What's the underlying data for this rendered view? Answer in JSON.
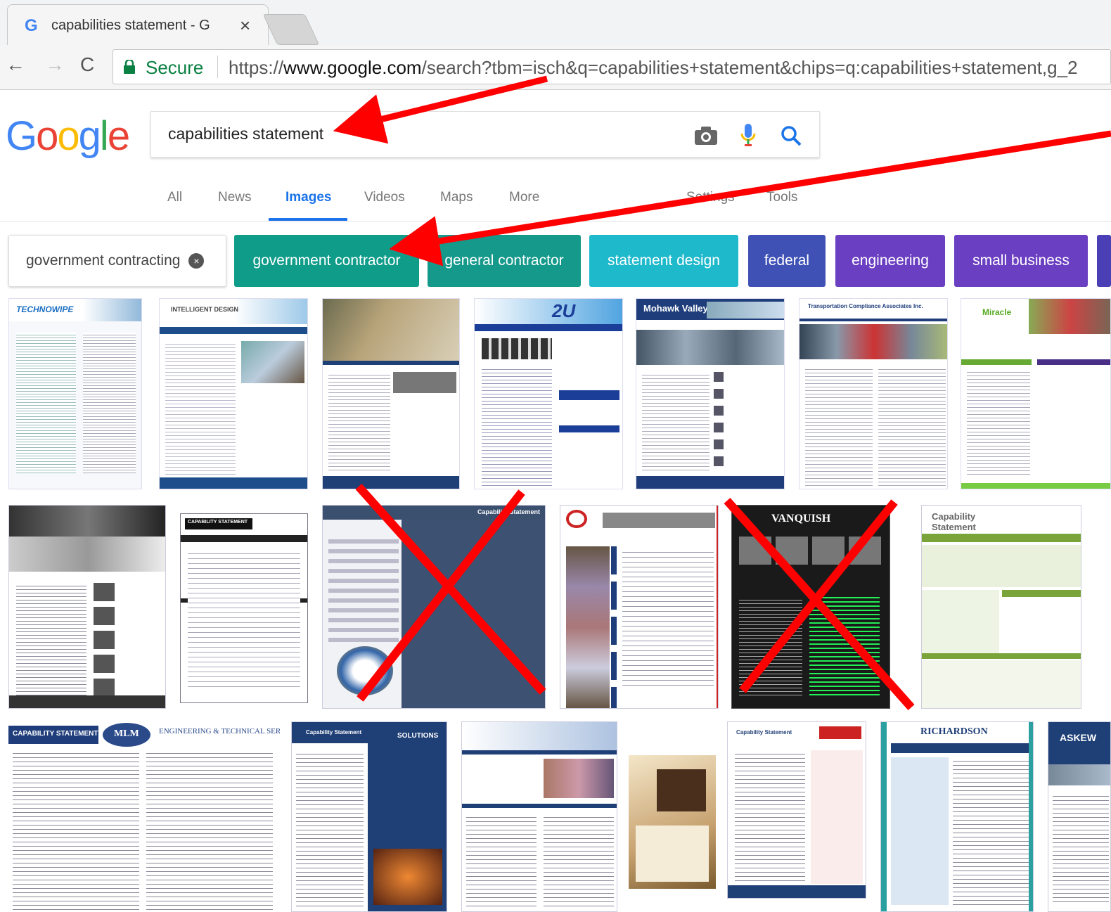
{
  "browser": {
    "tab_title": "capabilities statement - G",
    "tab_favicon": "G",
    "close_icon": "×",
    "back_icon": "←",
    "forward_icon": "→",
    "reload_icon": "C",
    "secure_label": "Secure",
    "url_scheme": "https://",
    "url_host": "www.google.com",
    "url_path": "/search?tbm=isch&q=capabilities+statement&chips=q:capabilities+statement,g_2"
  },
  "google": {
    "logo": [
      "G",
      "o",
      "o",
      "g",
      "l",
      "e"
    ],
    "search_value": "capabilities statement",
    "tabs": [
      "All",
      "News",
      "Images",
      "Videos",
      "Maps",
      "More",
      "Settings",
      "Tools"
    ],
    "active_tab": "Images",
    "chips": [
      {
        "label": "government contracting",
        "color": "#ffffff",
        "selected": true,
        "remove_icon": "×"
      },
      {
        "label": "government contractor",
        "color": "#0f9d8a"
      },
      {
        "label": "general contractor",
        "color": "#14998a"
      },
      {
        "label": "statement design",
        "color": "#1fb9cc"
      },
      {
        "label": "federal",
        "color": "#3f51b5"
      },
      {
        "label": "engineering",
        "color": "#6a3fc1"
      },
      {
        "label": "small business",
        "color": "#6a3fc1"
      }
    ]
  },
  "thumbnails": {
    "row1": [
      "TECHNOWIPE",
      "INTELLIGENT DESIGN",
      "",
      "2U",
      "Mohawk Valley",
      "Transportation Compliance Associates Inc.",
      "Miracle"
    ],
    "row2": [
      "",
      "CAPABILITY STATEMENT",
      "Capability Statement",
      "",
      "VANQUISH",
      "Capability Statement",
      ""
    ],
    "row3": [
      "CAPABILITY STATEMENT",
      "MLM",
      "ENGINEERING & TECHNICAL SERVICES",
      "Capability Statement",
      "SOLUTIONS",
      "",
      "",
      "Capability Statement",
      "RICHARDSON",
      "ASKEW"
    ]
  },
  "colors": {
    "annotation_red": "#ff0000",
    "link_blue": "#1a73e8",
    "secure_green": "#0b8043"
  }
}
